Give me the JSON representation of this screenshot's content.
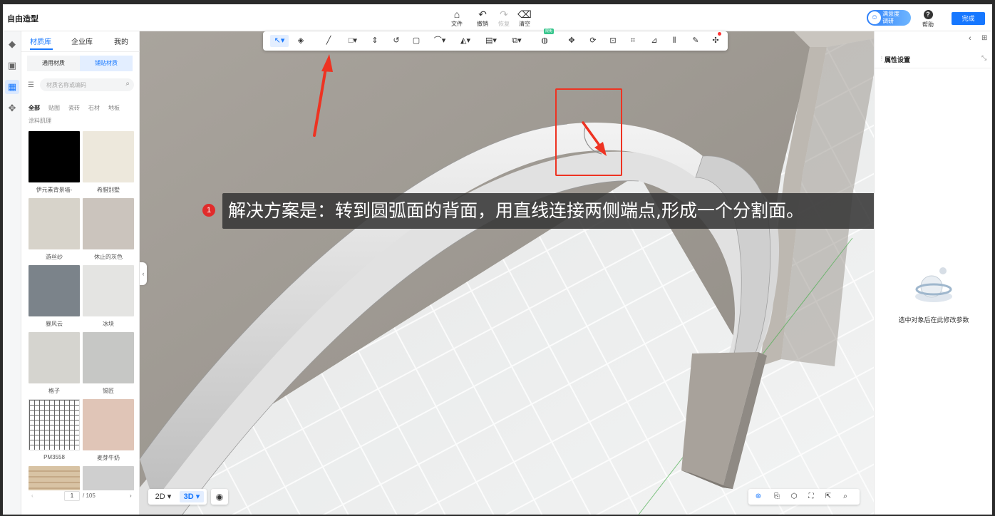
{
  "app": {
    "title": "自由造型"
  },
  "topbar": {
    "tools": [
      {
        "label": "文件",
        "icon": "house-file-icon"
      },
      {
        "label": "撤销",
        "icon": "undo-icon"
      },
      {
        "label": "恢复",
        "icon": "redo-icon",
        "disabled": true
      },
      {
        "label": "清空",
        "icon": "eraser-icon"
      }
    ],
    "survey": {
      "line1": "满意度",
      "line2": "调研"
    },
    "help_label": "帮助",
    "done_label": "完成"
  },
  "left_panel": {
    "tabs": [
      "材质库",
      "企业库",
      "我的"
    ],
    "active_tab": 0,
    "segments": [
      "通用材质",
      "铺贴材质"
    ],
    "active_segment": 1,
    "search": {
      "placeholder": "材质名称或编码",
      "value": ""
    },
    "filters": [
      "全部",
      "贴图",
      "瓷砖",
      "石材",
      "地板",
      "涂料肌理"
    ],
    "active_filter": 0,
    "materials": [
      {
        "name": "伊元素背景墙-",
        "color": "#000000"
      },
      {
        "name": "希腊别墅",
        "color": "#ede8dc"
      },
      {
        "name": "游丝纱",
        "color": "#d7d3ca"
      },
      {
        "name": "休止的灰色",
        "color": "#cbc4bd"
      },
      {
        "name": "暴风云",
        "color": "#7b838a"
      },
      {
        "name": "冰块",
        "color": "#e4e4e2"
      },
      {
        "name": "格子",
        "color": "#d5d4cf"
      },
      {
        "name": "锡匠",
        "color": "#c6c7c5"
      },
      {
        "name": "PM3558",
        "color": "#ffffff"
      },
      {
        "name": "麦芽牛奶",
        "color": "#e0c5b7"
      },
      {
        "name": "",
        "color": "#d8c3a4"
      },
      {
        "name": "",
        "color": "#cfcfcf"
      }
    ],
    "pagination": {
      "current": "1",
      "total": "/ 105"
    }
  },
  "toolbar": {
    "tools": [
      "select-arrow-icon",
      "paint-bucket-icon",
      "line-icon",
      "rectangle-icon",
      "push-pull-icon",
      "offset-icon",
      "face-icon",
      "arc-icon",
      "mirror-icon",
      "array-icon",
      "boolean-icon",
      "sphere-beta-icon",
      "move-icon",
      "rotate-icon",
      "scale-icon",
      "align-icon",
      "section-icon",
      "distribute-icon",
      "brush-icon",
      "gizmo-icon"
    ],
    "beta_label": "限免"
  },
  "caption": {
    "step": "1",
    "text": "解决方案是：转到圆弧面的背面，用直线连接两侧端点,形成一个分割面。"
  },
  "viewport": {
    "view_modes": [
      "2D",
      "3D"
    ],
    "active_view_mode": "3D",
    "view_tools": [
      "orbit-icon",
      "camera-icon",
      "cube-icon",
      "fit-icon",
      "export-icon",
      "zoom-region-icon"
    ]
  },
  "right_panel": {
    "title": "属性设置",
    "empty_text": "选中对象后在此修改参数"
  },
  "colors": {
    "accent": "#1677ff",
    "annotation_red": "#ee3322",
    "wall": "#a49f98",
    "arch": "#e2e2e2"
  }
}
